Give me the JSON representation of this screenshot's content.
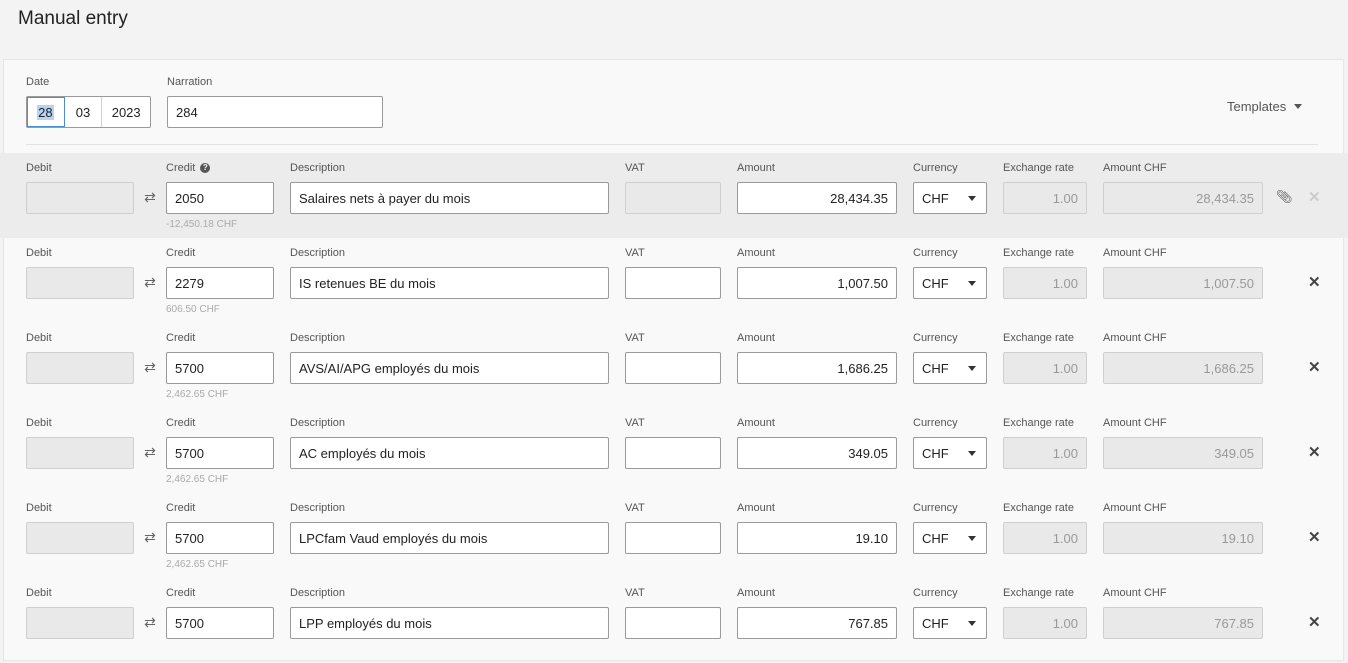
{
  "page_title": "Manual entry",
  "header": {
    "date_label": "Date",
    "date_day": "28",
    "date_month": "03",
    "date_year": "2023",
    "narration_label": "Narration",
    "narration_value": "284",
    "templates_label": "Templates"
  },
  "labels": {
    "debit": "Debit",
    "credit": "Credit",
    "description": "Description",
    "vat": "VAT",
    "amount": "Amount",
    "currency": "Currency",
    "exchange_rate": "Exchange rate",
    "amount_chf": "Amount CHF"
  },
  "rows": [
    {
      "credit": "2050",
      "hint": "-12,450.18 CHF",
      "description": "Salaires nets à payer du mois",
      "amount": "28,434.35",
      "currency": "CHF",
      "rate": "1.00",
      "amount_chf": "28,434.35"
    },
    {
      "credit": "2279",
      "hint": "606.50 CHF",
      "description": "IS retenues BE du mois",
      "amount": "1,007.50",
      "currency": "CHF",
      "rate": "1.00",
      "amount_chf": "1,007.50"
    },
    {
      "credit": "5700",
      "hint": "2,462.65 CHF",
      "description": "AVS/AI/APG employés du mois",
      "amount": "1,686.25",
      "currency": "CHF",
      "rate": "1.00",
      "amount_chf": "1,686.25"
    },
    {
      "credit": "5700",
      "hint": "2,462.65 CHF",
      "description": "AC employés du mois",
      "amount": "349.05",
      "currency": "CHF",
      "rate": "1.00",
      "amount_chf": "349.05"
    },
    {
      "credit": "5700",
      "hint": "2,462.65 CHF",
      "description": "LPCfam Vaud employés du mois",
      "amount": "19.10",
      "currency": "CHF",
      "rate": "1.00",
      "amount_chf": "19.10"
    },
    {
      "credit": "5700",
      "hint": "",
      "description": "LPP employés du mois",
      "amount": "767.85",
      "currency": "CHF",
      "rate": "1.00",
      "amount_chf": "767.85"
    }
  ],
  "icons": {
    "swap": "swap-arrows-icon",
    "help": "question-circle-icon",
    "attach": "paperclip-icon",
    "remove": "close-icon"
  }
}
